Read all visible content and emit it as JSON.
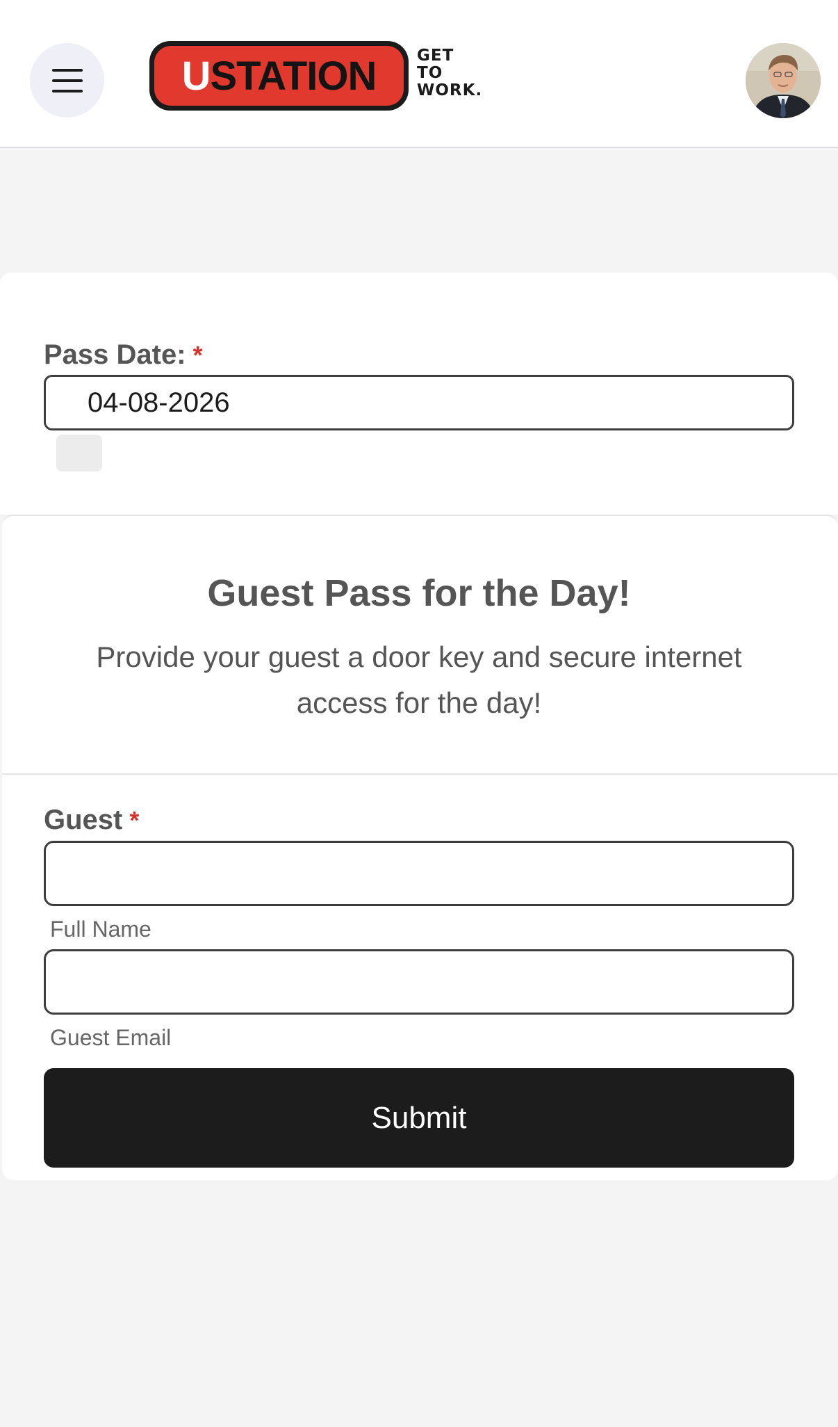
{
  "header": {
    "menu_icon": "hamburger-menu-icon",
    "logo": {
      "brand_first_letter": "U",
      "brand_rest": "STATION",
      "tagline_lines": [
        "GET",
        "TO",
        "WORK."
      ],
      "colors": {
        "pill_red": "#e2392f",
        "pill_border": "#1b1b1b"
      }
    },
    "avatar_icon": "user-avatar"
  },
  "pass_date": {
    "label": "Pass Date:",
    "required_marker": "*",
    "value": "04-08-2026"
  },
  "intro": {
    "title": "Guest Pass for the Day!",
    "description": "Provide your guest a door key and secure internet access for the day!"
  },
  "guest": {
    "label": "Guest",
    "required_marker": "*",
    "full_name": {
      "value": "",
      "sublabel": "Full Name"
    },
    "email": {
      "value": "",
      "sublabel": "Guest Email"
    }
  },
  "submit": {
    "label": "Submit"
  },
  "colors": {
    "accent_required": "#d6322b",
    "button_bg": "#1c1c1c",
    "page_bg": "#f4f4f5"
  }
}
